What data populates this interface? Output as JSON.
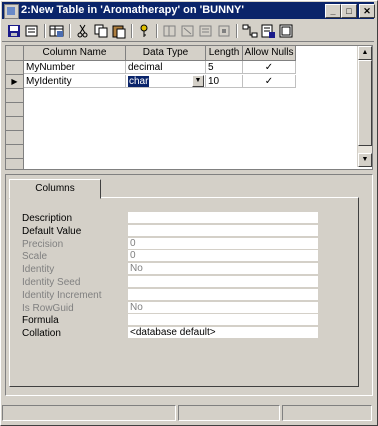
{
  "window": {
    "title": "2:New Table in 'Aromatherapy' on 'BUNNY'"
  },
  "titlebar": {
    "minimize": "_",
    "maximize": "□",
    "close": "✕"
  },
  "toolbar": {
    "icons": [
      "save-icon",
      "properties-icon",
      "table-icon",
      "cut-icon",
      "copy-icon",
      "paste-icon",
      "primary-key-icon",
      "insert-column-icon",
      "delete-column-icon",
      "manage-indexes-icon",
      "manage-constraints-icon",
      "relationships-icon",
      "save-change-script-icon",
      "manage-triggers-icon"
    ]
  },
  "grid": {
    "headers": [
      "Column Name",
      "Data Type",
      "Length",
      "Allow Nulls"
    ],
    "rows": [
      {
        "name": "MyNumber",
        "type": "decimal",
        "length": "5",
        "allow_nulls": "✓"
      },
      {
        "name": "MyIdentity",
        "type": "char",
        "length": "10",
        "allow_nulls": "✓"
      }
    ],
    "dropdown_arrow": "▼",
    "current_row_marker": "▶",
    "scroll_up": "▲",
    "scroll_down": "▼"
  },
  "properties": {
    "tab_label": "Columns",
    "rows": [
      {
        "label": "Description",
        "value": "",
        "dim": false
      },
      {
        "label": "Default Value",
        "value": "",
        "dim": false
      },
      {
        "label": "Precision",
        "value": "0",
        "dim": true
      },
      {
        "label": "Scale",
        "value": "0",
        "dim": true
      },
      {
        "label": "Identity",
        "value": "No",
        "dim": true
      },
      {
        "label": "Identity Seed",
        "value": "",
        "dim": true
      },
      {
        "label": "Identity Increment",
        "value": "",
        "dim": true
      },
      {
        "label": "Is RowGuid",
        "value": "No",
        "dim": true
      },
      {
        "label": "Formula",
        "value": "",
        "dim": false
      },
      {
        "label": "Collation",
        "value": "<database default>",
        "dim": false
      }
    ]
  },
  "colors": {
    "title_bg": "#0a246a",
    "face": "#d4d0c8",
    "selection": "#0a246a"
  }
}
